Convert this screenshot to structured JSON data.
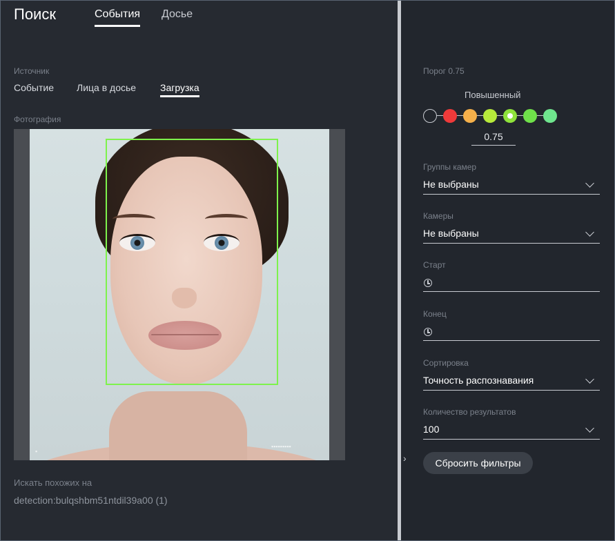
{
  "header": {
    "title": "Поиск",
    "tabs": [
      {
        "label": "События",
        "active": true
      },
      {
        "label": "Досье",
        "active": false
      }
    ]
  },
  "source": {
    "label": "Источник",
    "tabs": [
      {
        "label": "Событие",
        "active": false
      },
      {
        "label": "Лица в досье",
        "active": false
      },
      {
        "label": "Загрузка",
        "active": true
      }
    ]
  },
  "photo": {
    "label": "Фотография",
    "face_box_color": "#7ef24c"
  },
  "similar": {
    "label": "Искать похожих на",
    "value": "detection:bulqshbm51ntdil39a00 (1)"
  },
  "filters": {
    "threshold": {
      "label": "Порог 0.75",
      "mode": "Повышенный",
      "value": "0.75",
      "levels": [
        {
          "color": "#22262d",
          "border": "#c9ccd2",
          "selected": false
        },
        {
          "color": "#ef3a3a",
          "selected": false
        },
        {
          "color": "#f5b04a",
          "selected": false
        },
        {
          "color": "#b7ea3b",
          "selected": false
        },
        {
          "color": "#8fe33b",
          "selected": true
        },
        {
          "color": "#6fe04a",
          "selected": false
        },
        {
          "color": "#6fe58e",
          "selected": false
        }
      ]
    },
    "camera_groups": {
      "label": "Группы камер",
      "value": "Не выбраны"
    },
    "cameras": {
      "label": "Камеры",
      "value": "Не выбраны"
    },
    "start": {
      "label": "Старт",
      "value": ""
    },
    "end": {
      "label": "Конец",
      "value": ""
    },
    "sort": {
      "label": "Сортировка",
      "value": "Точность распознавания"
    },
    "count": {
      "label": "Количество результатов",
      "value": "100"
    },
    "reset_label": "Сбросить фильтры"
  },
  "icons": {
    "collapse": "chevron-right-icon",
    "clock": "clock-icon",
    "dropdown": "chevron-down-icon"
  }
}
